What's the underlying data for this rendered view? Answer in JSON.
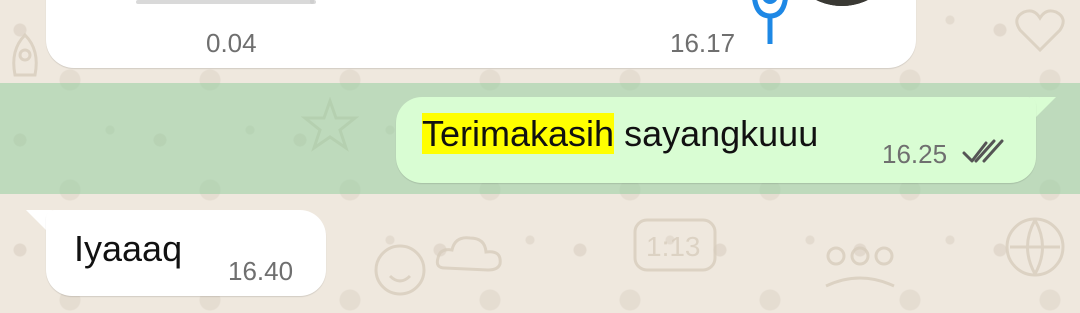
{
  "voice_message": {
    "duration": "0.04",
    "time": "16.17",
    "mic_icon": "mic-icon",
    "mic_color": "#1e88e5"
  },
  "outgoing_message": {
    "highlighted_word": "Terimakasih",
    "rest_text": " sayangkuuu",
    "time": "16.25",
    "status_icon": "double-check-icon",
    "highlight_color": "#ffff00",
    "bubble_color": "#d9fdd3"
  },
  "incoming_message": {
    "text": "Iyaaaq",
    "time": "16.40"
  }
}
